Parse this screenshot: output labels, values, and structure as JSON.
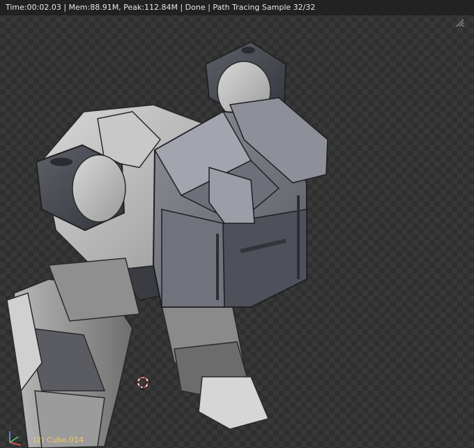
{
  "render": {
    "status_text": "Time:00:02.03 | Mem:88.91M, Peak:112.84M | Done | Path Tracing Sample 32/32",
    "object_label": "(2) Cube.014"
  },
  "icons": {
    "viewport_split": "grid-icon",
    "cursor": "3d-cursor-icon",
    "axes": "axis-gizmo-icon"
  },
  "colors": {
    "object_label": "#f0c86a",
    "cursor": "#e04040"
  }
}
